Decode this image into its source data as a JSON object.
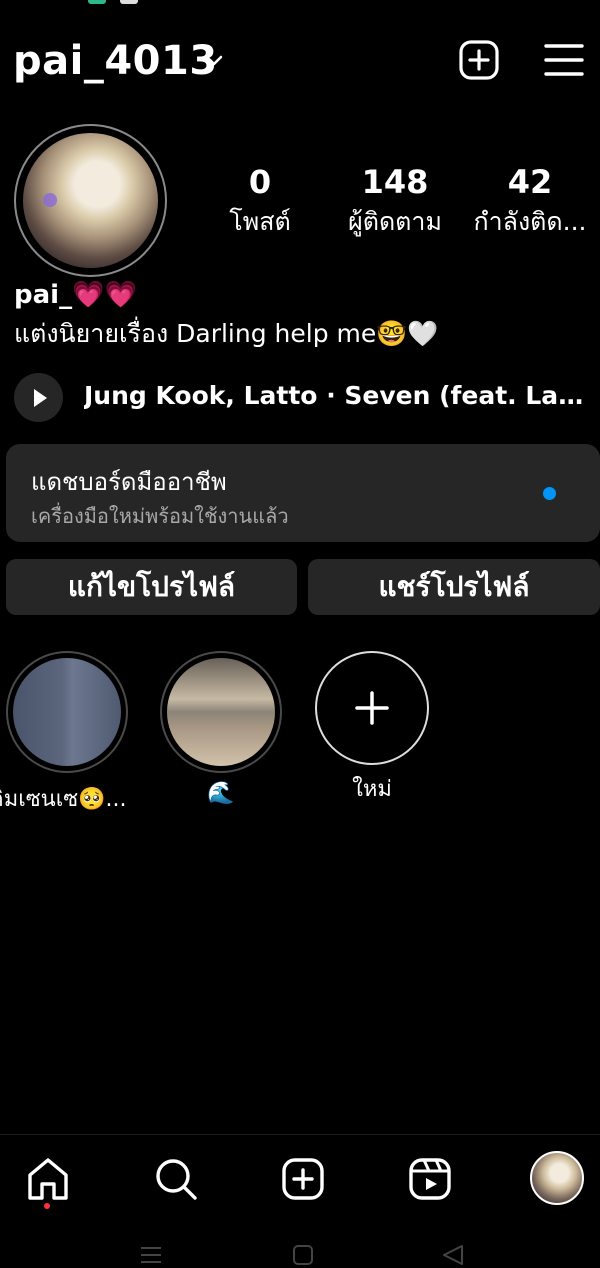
{
  "header": {
    "username": "pai_4013"
  },
  "profile": {
    "stats": [
      {
        "value": "0",
        "label": "โพสต์"
      },
      {
        "value": "148",
        "label": "ผู้ติดตาม"
      },
      {
        "value": "42",
        "label": "กำลังติด..."
      }
    ],
    "display_name": "pai_💗💗",
    "bio": "แต่งนิยายเรื่อง Darling help me🤓🤍"
  },
  "music": {
    "title": "Jung Kook, Latto · Seven (feat. Latto..."
  },
  "dashboard": {
    "title": "แดชบอร์ดมืออาชีพ",
    "subtitle": "เครื่องมือใหม่พร้อมใช้งานแล้ว"
  },
  "buttons": {
    "edit_profile": "แก้ไขโปรไฟล์",
    "share_profile": "แชร์โปรไฟล์"
  },
  "highlights": [
    {
      "caption": "คิมเซนเซ🥺..."
    },
    {
      "caption": "🌊"
    },
    {
      "caption": "ใหม่"
    }
  ],
  "nav": {
    "items": [
      "home-icon",
      "search-icon",
      "create-icon",
      "reels-icon",
      "profile-avatar"
    ],
    "active": "home-icon"
  },
  "colors": {
    "background": "#000000",
    "surface": "#262626",
    "accent_blue": "#0095f6",
    "notification_red": "#ff3040"
  }
}
